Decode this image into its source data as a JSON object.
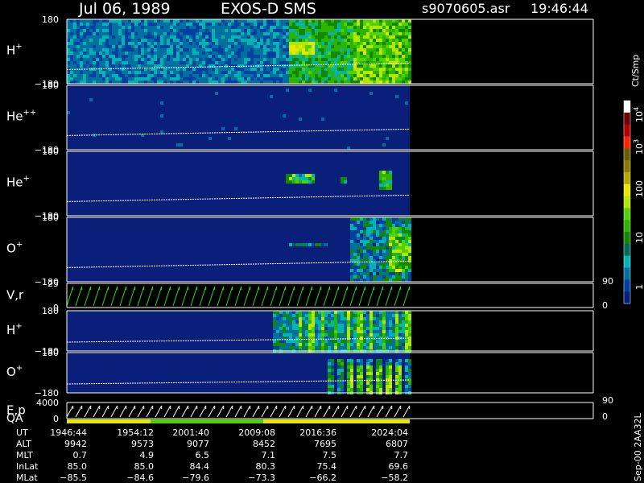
{
  "header": {
    "date": "Jul 06, 1989",
    "instrument": "EXOS-D SMS",
    "filename": "s9070605.asr",
    "time": "19:46:44"
  },
  "colorbar": {
    "unit": "Ct/Smp",
    "ticks": [
      "10",
      "10",
      "100",
      "10",
      "1"
    ],
    "tick_exponents": [
      "4",
      "3",
      "",
      "",
      ""
    ],
    "colors": [
      "#ffffff",
      "#6e0000",
      "#b40000",
      "#ff2200",
      "#6a5a00",
      "#8a7a00",
      "#b4a800",
      "#e6e600",
      "#b4e600",
      "#50d200",
      "#2bb400",
      "#118800",
      "#006a5a",
      "#00b4b4",
      "#0070a0",
      "#0040a0",
      "#002080"
    ]
  },
  "side_note": "Sep-00  2AA32L",
  "chart_data": [
    {
      "type": "heatmap",
      "label": "H",
      "label_sup": "+",
      "ytop": "180",
      "ybottom": "−180",
      "ylim": [
        -180,
        180
      ],
      "activity": "h"
    },
    {
      "type": "heatmap",
      "label": "He",
      "label_sup": "++",
      "ytop": "180",
      "ybottom": "−180",
      "ylim": [
        -180,
        180
      ],
      "activity": "he2"
    },
    {
      "type": "heatmap",
      "label": "He",
      "label_sup": "+",
      "ytop": "180",
      "ybottom": "−180",
      "ylim": [
        -180,
        180
      ],
      "activity": "he1"
    },
    {
      "type": "heatmap",
      "label": "O",
      "label_sup": "+",
      "ytop": "180",
      "ybottom": "−180",
      "ylim": [
        -180,
        180
      ],
      "activity": "o"
    },
    {
      "type": "line",
      "label": "V,r",
      "label_sup": "",
      "ytop": "25",
      "ybottom": "0",
      "ylim": [
        0,
        25
      ],
      "right_top": "90",
      "right_bottom": "0",
      "color": "#20e020"
    },
    {
      "type": "heatmap",
      "label": "H",
      "label_sup": "+",
      "ytop": "180",
      "ybottom": "−180",
      "ylim": [
        -180,
        180
      ],
      "activity": "h2"
    },
    {
      "type": "heatmap",
      "label": "O",
      "label_sup": "+",
      "ytop": "180",
      "ybottom": "−180",
      "ylim": [
        -180,
        180
      ],
      "activity": "o2"
    },
    {
      "type": "line",
      "label": "E,p",
      "label_sup": "",
      "label2": "QA",
      "ytop": "4000",
      "ybottom": "0",
      "ylim": [
        0,
        4000
      ],
      "right_top": "90",
      "right_bottom": "0",
      "color": "#ffffff"
    }
  ],
  "qa_bar": {
    "segments": [
      {
        "from": "1946:44",
        "to": "1958:00",
        "color": "#e6e600"
      },
      {
        "from": "1958:00",
        "to": "2011:00",
        "color": "#50d200"
      },
      {
        "from": "2011:00",
        "to": "2027:00",
        "color": "#e6e600"
      }
    ]
  },
  "time_table": {
    "rows": [
      {
        "label": "UT",
        "values": [
          "1946:44",
          "1954:12",
          "2001:40",
          "2009:08",
          "2016:36",
          "2024:04"
        ]
      },
      {
        "label": "ALT",
        "values": [
          "9942",
          "9573",
          "9077",
          "8452",
          "7695",
          "6807"
        ]
      },
      {
        "label": "MLT",
        "values": [
          "0.7",
          "4.9",
          "6.5",
          "7.1",
          "7.5",
          "7.7"
        ]
      },
      {
        "label": "InLat",
        "values": [
          "85.0",
          "85.0",
          "84.4",
          "80.3",
          "75.4",
          "69.6"
        ]
      },
      {
        "label": "MLat",
        "values": [
          "−85.5",
          "−84.6",
          "−79.6",
          "−73.3",
          "−66.2",
          "−58.2"
        ]
      }
    ]
  }
}
